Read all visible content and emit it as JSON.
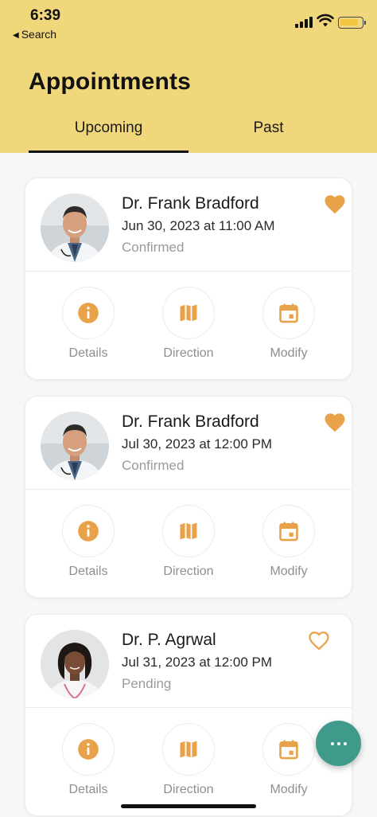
{
  "status_bar": {
    "time": "6:39",
    "back_label": "Search"
  },
  "header": {
    "title": "Appointments"
  },
  "tabs": [
    {
      "label": "Upcoming",
      "active": true
    },
    {
      "label": "Past",
      "active": false
    }
  ],
  "appointments": [
    {
      "doctor": "Dr. Frank Bradford",
      "datetime": "Jun 30, 2023 at 11:00 AM",
      "status": "Confirmed",
      "favorite": true
    },
    {
      "doctor": "Dr. Frank Bradford",
      "datetime": "Jul 30, 2023 at 12:00 PM",
      "status": "Confirmed",
      "favorite": true
    },
    {
      "doctor": "Dr. P. Agrwal",
      "datetime": "Jul 31, 2023 at 12:00 PM",
      "status": "Pending",
      "favorite": false
    }
  ],
  "actions": {
    "details": "Details",
    "direction": "Direction",
    "modify": "Modify"
  },
  "icons": {
    "details": "info-icon",
    "direction": "map-icon",
    "modify": "calendar-icon",
    "favorite": "heart-icon",
    "fab": "more-icon"
  },
  "colors": {
    "header_bg": "#f0d77b",
    "accent": "#e8a24a",
    "fab": "#3f9a8c",
    "status_text": "#9a9a9a"
  }
}
